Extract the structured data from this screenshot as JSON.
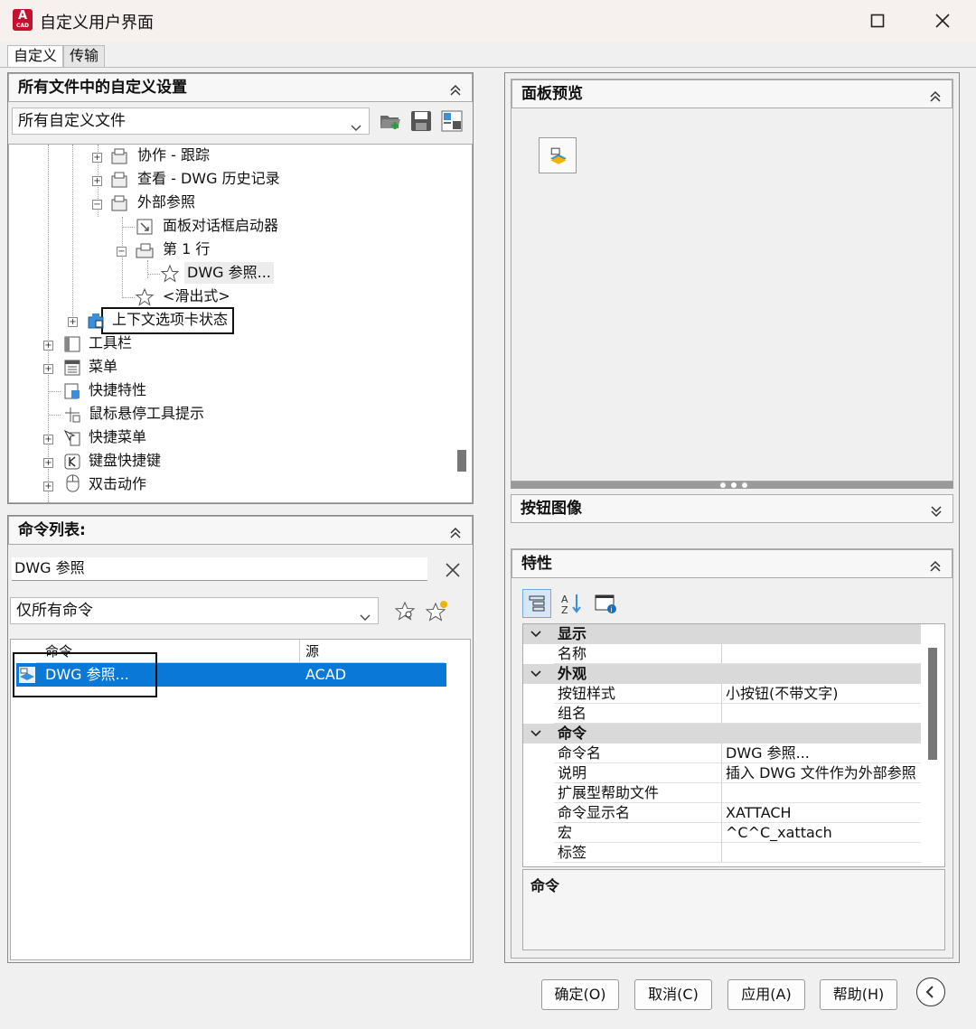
{
  "window": {
    "title": "自定义用户界面",
    "app_icon_text": "A",
    "app_icon_sub": "CAD"
  },
  "tabs": [
    {
      "label": "自定义"
    },
    {
      "label": "传输"
    }
  ],
  "left_top": {
    "title": "所有文件中的自定义设置",
    "combo_value": "所有自定义文件",
    "tree": [
      {
        "label": "协作 - 跟踪"
      },
      {
        "label": "查看 - DWG 历史记录"
      },
      {
        "label": "外部参照"
      },
      {
        "label": "面板对话框启动器"
      },
      {
        "label": "第 1 行"
      },
      {
        "label": "DWG 参照..."
      },
      {
        "label": "<滑出式>"
      },
      {
        "label": "上下文选项卡状态"
      },
      {
        "label": "工具栏"
      },
      {
        "label": "菜单"
      },
      {
        "label": "快捷特性"
      },
      {
        "label": "鼠标悬停工具提示"
      },
      {
        "label": "快捷菜单"
      },
      {
        "label": "键盘快捷键"
      },
      {
        "label": "双击动作"
      }
    ]
  },
  "command_list": {
    "title": "命令列表:",
    "search_value": "DWG 参照",
    "filter_value": "仅所有命令",
    "columns": {
      "command": "命令",
      "source": "源"
    },
    "rows": [
      {
        "command": "DWG 参照...",
        "source": "ACAD"
      }
    ]
  },
  "right": {
    "panel_preview_title": "面板预览",
    "button_image_title": "按钮图像",
    "properties_title": "特性",
    "properties": [
      {
        "category": "显示",
        "items": [
          {
            "name": "名称",
            "value": ""
          }
        ]
      },
      {
        "category": "外观",
        "items": [
          {
            "name": "按钮样式",
            "value": "小按钮(不带文字)"
          },
          {
            "name": "组名",
            "value": ""
          }
        ]
      },
      {
        "category": "命令",
        "items": [
          {
            "name": "命令名",
            "value": "DWG 参照..."
          },
          {
            "name": "说明",
            "value": "插入 DWG 文件作为外部参照"
          },
          {
            "name": "扩展型帮助文件",
            "value": ""
          },
          {
            "name": "命令显示名",
            "value": "XATTACH"
          },
          {
            "name": "宏",
            "value": "^C^C_xattach"
          },
          {
            "name": "标签",
            "value": ""
          }
        ]
      }
    ],
    "description_title": "命令"
  },
  "footer": {
    "ok": "确定(O)",
    "cancel": "取消(C)",
    "apply": "应用(A)",
    "help": "帮助(H)"
  },
  "colors": {
    "selection": "#0a78d7",
    "highlight_box": "#111111",
    "app_red": "#c8102e"
  }
}
